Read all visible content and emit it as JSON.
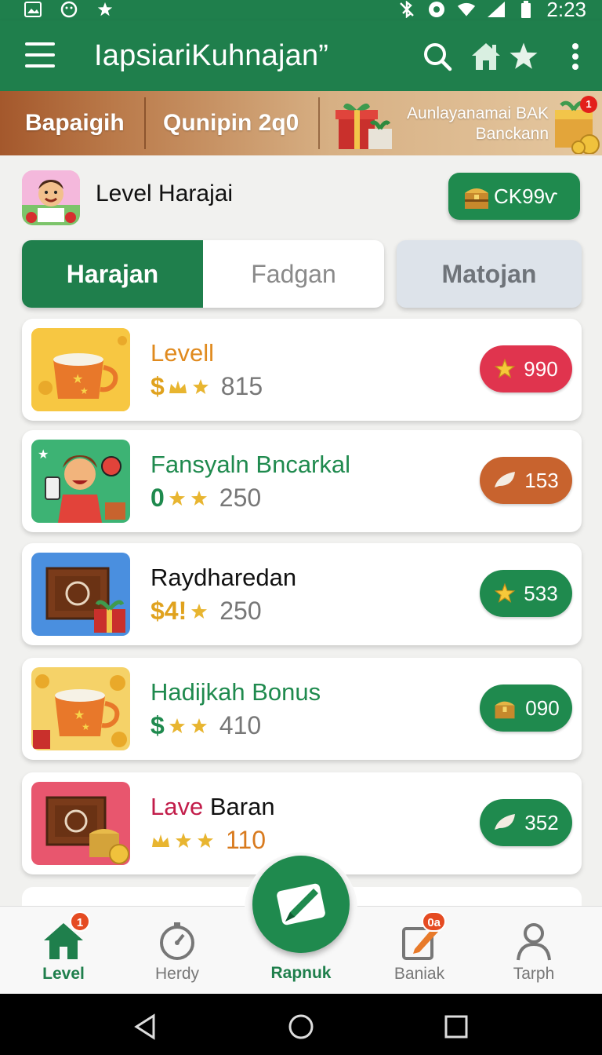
{
  "status_bar": {
    "time": "2:23"
  },
  "app_bar": {
    "title": "IapsiariKuhnajan”"
  },
  "banner": {
    "item1": "Bapaigih",
    "item2": "Qunipin 2q0",
    "promo_line1": "Aunlayanamai BAK",
    "promo_line2": "Banckann",
    "badge": "1"
  },
  "profile": {
    "title": "Level Harajai",
    "coins": "CK99ѵ"
  },
  "tabs": {
    "active": "Harajan",
    "second": "Fadgan",
    "third": "Matojan"
  },
  "items": [
    {
      "title": "Levell",
      "title_color": "#e08a1e",
      "currency": "$",
      "currency_color": "#e0a21e",
      "value": "815",
      "pill": "990",
      "pill_color": "#e0344e",
      "pill_icon": "star-icon"
    },
    {
      "title": "Fansyaln Bncarkal",
      "title_color": "#1f8a4e",
      "currency": "0",
      "currency_color": "#1f8a4e",
      "value": "250",
      "pill": "153",
      "pill_color": "#c8632e",
      "pill_icon": "leaf-icon"
    },
    {
      "title": "Raydharedan",
      "title_color": "#111111",
      "currency": "$4!",
      "currency_color": "#e0a21e",
      "value": "250",
      "pill": "533",
      "pill_color": "#1f8a4e",
      "pill_icon": "star-icon"
    },
    {
      "title": "Hadijkah Bonus",
      "title_color": "#1f8a4e",
      "currency": "$",
      "currency_color": "#1f8a4e",
      "value": "410",
      "pill": "090",
      "pill_color": "#1f8a4e",
      "pill_icon": "chest-icon"
    },
    {
      "title_part1": "Lave",
      "title_part2": " Baran",
      "title_color": "#c21d4a",
      "currency": "",
      "currency_color": "#e0a21e",
      "value": "110",
      "pill": "352",
      "pill_color": "#1f8a4e",
      "pill_icon": "leaf-icon"
    }
  ],
  "bottom_nav": {
    "level": "Level",
    "level_badge": "1",
    "herdy": "Herdy",
    "rapnuk": "Rapnuk",
    "baniak": "Baniak",
    "baniak_badge": "0а",
    "tarph": "Tarph"
  },
  "colors": {
    "primary": "#1f7f4c",
    "accent_red": "#e0344e",
    "accent_orange": "#c8632e",
    "gold": "#e8b530"
  }
}
